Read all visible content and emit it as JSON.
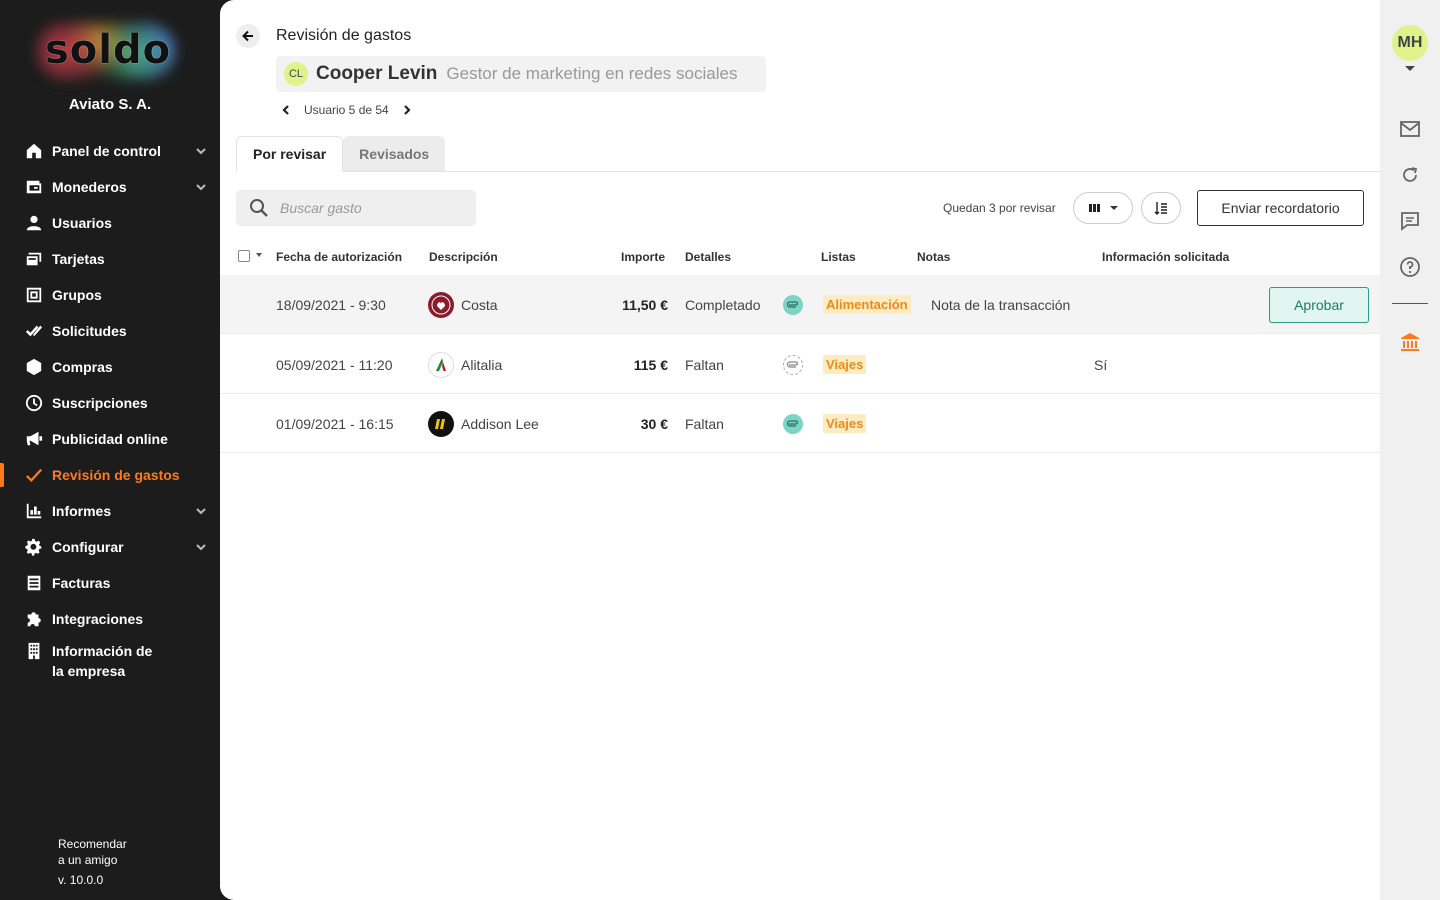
{
  "sidebar": {
    "logo_text": "soldo",
    "company": "Aviato S. A.",
    "items": [
      {
        "label": "Panel de control",
        "icon": "home-icon"
      },
      {
        "label": "Monederos",
        "icon": "wallet-icon"
      },
      {
        "label": "Usuarios",
        "icon": "user-icon"
      },
      {
        "label": "Tarjetas",
        "icon": "cards-icon"
      },
      {
        "label": "Grupos",
        "icon": "groups-icon"
      },
      {
        "label": "Solicitudes",
        "icon": "double-check-icon"
      },
      {
        "label": "Compras",
        "icon": "hexagon-icon"
      },
      {
        "label": "Suscripciones",
        "icon": "clock-icon"
      },
      {
        "label": "Publicidad online",
        "icon": "megaphone-icon"
      },
      {
        "label": "Revisión de gastos",
        "icon": "check-icon",
        "active": true
      },
      {
        "label": "Informes",
        "icon": "bar-chart-icon"
      },
      {
        "label": "Configurar",
        "icon": "gear-icon"
      },
      {
        "label": "Facturas",
        "icon": "invoice-icon"
      },
      {
        "label": "Integraciones",
        "icon": "puzzle-icon"
      },
      {
        "label_line1": "Información de",
        "label_line2": "la empresa",
        "icon": "building-icon"
      }
    ],
    "footer": {
      "recommend_line1": "Recomendar",
      "recommend_line2": "a un amigo",
      "version": "v. 10.0.0"
    }
  },
  "header": {
    "title": "Revisión de gastos",
    "user": {
      "initials": "CL",
      "name": "Cooper Levin",
      "role": "Gestor de marketing en redes sociales"
    },
    "pager": "Usuario 5 de 54"
  },
  "tabs": [
    {
      "label": "Por revisar",
      "active": true
    },
    {
      "label": "Revisados"
    }
  ],
  "toolbar": {
    "search_placeholder": "Buscar gasto",
    "remaining": "Quedan 3 por revisar",
    "remind_label": "Enviar recordatorio"
  },
  "table": {
    "columns": [
      "Fecha de autorización",
      "Descripción",
      "Importe",
      "Detalles",
      "Listas",
      "Notas",
      "Información solicitada"
    ],
    "rows": [
      {
        "date": "18/09/2021 - 9:30",
        "merchant": "Costa",
        "amount": "11,50 €",
        "details": "Completado",
        "receipt": "attached",
        "list": "Alimentación",
        "notes": "Nota de la transacción",
        "info": "",
        "action": "Aprobar"
      },
      {
        "date": "05/09/2021 - 11:20",
        "merchant": "Alitalia",
        "amount": "115 €",
        "details": "Faltan",
        "receipt": "missing",
        "list": "Viajes",
        "notes": "",
        "info": "Sí",
        "action": ""
      },
      {
        "date": "01/09/2021 - 16:15",
        "merchant": "Addison Lee",
        "amount": "30 €",
        "details": "Faltan",
        "receipt": "attached",
        "list": "Viajes",
        "notes": "",
        "info": "",
        "action": ""
      }
    ]
  },
  "rail": {
    "initials": "MH"
  },
  "colors": {
    "accent": "#ff7a1a",
    "sidebar_bg": "#1c1c1c",
    "approve_border": "#2d9d80",
    "tag_bg": "#fdebc2",
    "tag_text": "#f08a16"
  }
}
